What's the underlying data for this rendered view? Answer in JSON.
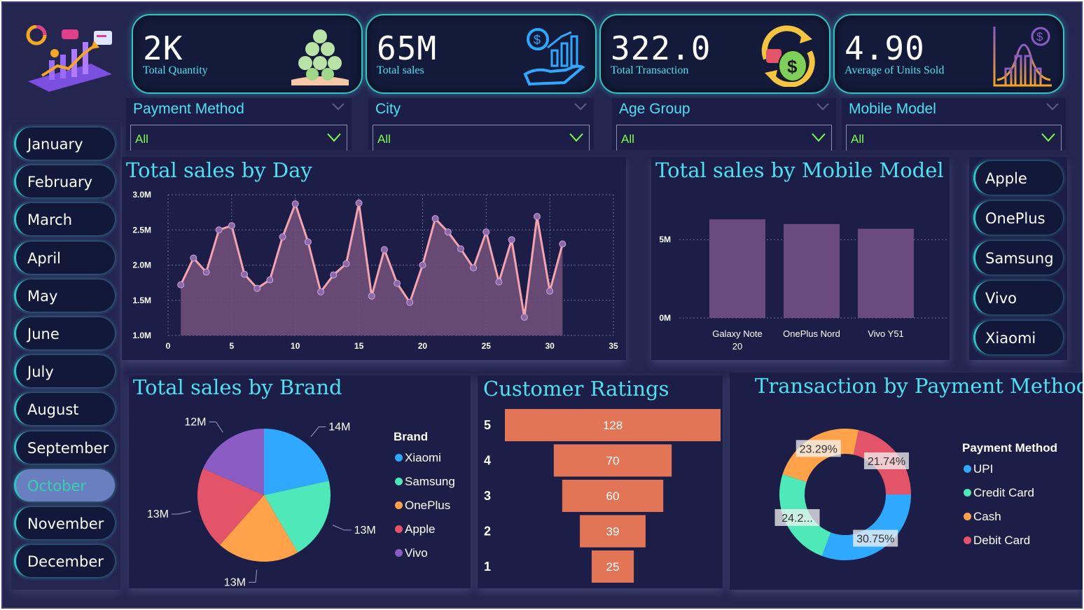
{
  "colors": {
    "accent": "#4fe0f0",
    "selected": "#7cff4a",
    "bar_model": "#6b4a80",
    "funnel": "#e37557",
    "line": "#f4a3b0",
    "point": "#8e67a8"
  },
  "kpis": [
    {
      "value": "2K",
      "label": "Total Quantity",
      "icon": "money-stack-icon"
    },
    {
      "value": "65M",
      "label": "Total sales",
      "icon": "growth-hand-icon"
    },
    {
      "value": "322.0",
      "label": "Total Transaction",
      "icon": "money-cycle-icon"
    },
    {
      "value": "4.90",
      "label": "Average of Units Sold",
      "icon": "bell-curve-icon"
    }
  ],
  "slicers": [
    {
      "title": "Payment Method",
      "selected": "All"
    },
    {
      "title": "City",
      "selected": "All"
    },
    {
      "title": "Age Group",
      "selected": "All"
    },
    {
      "title": "Mobile Model",
      "selected": "All"
    }
  ],
  "months": [
    "January",
    "February",
    "March",
    "April",
    "May",
    "June",
    "July",
    "August",
    "September",
    "October",
    "November",
    "December"
  ],
  "active_month": "October",
  "brand_buttons": [
    "Apple",
    "OnePlus",
    "Samsung",
    "Vivo",
    "Xiaomi"
  ],
  "chart_data": [
    {
      "type": "area",
      "title": "Total sales by Day",
      "xlim": [
        0,
        35
      ],
      "ylim": [
        1.0,
        3.0
      ],
      "x_ticks": [
        0,
        5,
        10,
        15,
        20,
        25,
        30,
        35
      ],
      "y_ticks": [
        1.0,
        1.5,
        2.0,
        2.5,
        3.0
      ],
      "y_tick_labels": [
        "1.0M",
        "1.5M",
        "2.0M",
        "2.5M",
        "3.0M"
      ],
      "x": [
        1,
        2,
        3,
        4,
        5,
        6,
        7,
        8,
        9,
        10,
        11,
        12,
        13,
        14,
        15,
        16,
        17,
        18,
        19,
        20,
        21,
        22,
        23,
        24,
        25,
        26,
        27,
        28,
        29,
        30,
        31
      ],
      "values": [
        1.72,
        2.1,
        1.9,
        2.5,
        2.56,
        1.87,
        1.67,
        1.79,
        2.4,
        2.87,
        2.33,
        1.62,
        1.86,
        2.02,
        2.88,
        1.56,
        2.22,
        1.74,
        1.47,
        2.0,
        2.66,
        2.47,
        2.23,
        1.96,
        2.47,
        1.76,
        2.36,
        1.26,
        2.69,
        1.63,
        2.3
      ]
    },
    {
      "type": "bar",
      "title": "Total sales by Mobile Model",
      "categories": [
        "Galaxy Note 20",
        "OnePlus Nord",
        "Vivo Y51"
      ],
      "values": [
        6.3,
        6.0,
        5.7
      ],
      "ylim": [
        0,
        8.5
      ],
      "y_ticks": [
        0,
        5
      ],
      "y_tick_labels": [
        "0M",
        "5M"
      ]
    },
    {
      "type": "pie",
      "title": "Total sales by Brand",
      "legend_title": "Brand",
      "categories": [
        "Xiaomi",
        "Samsung",
        "OnePlus",
        "Apple",
        "Vivo"
      ],
      "values": [
        14,
        13,
        13,
        13,
        12
      ],
      "labels": [
        "14M",
        "13M",
        "13M",
        "13M",
        "12M"
      ],
      "colors": [
        "#2fa8ff",
        "#4fe8b8",
        "#ffa24a",
        "#e35468",
        "#8a5cc4"
      ]
    },
    {
      "type": "bar",
      "title": "Customer Ratings",
      "categories": [
        "5",
        "4",
        "3",
        "2",
        "1"
      ],
      "values": [
        128,
        70,
        60,
        39,
        25
      ]
    },
    {
      "type": "pie",
      "title": "Transaction by Payment Method",
      "legend_title": "Payment Method",
      "categories": [
        "UPI",
        "Credit Card",
        "Cash",
        "Debit Card"
      ],
      "values": [
        30.75,
        24.2,
        23.29,
        21.74
      ],
      "labels": [
        "30.75%",
        "24.2...",
        "23.29%",
        "21.74%"
      ],
      "colors": [
        "#2fa8ff",
        "#4fe8b8",
        "#ffa24a",
        "#e35468"
      ]
    }
  ]
}
